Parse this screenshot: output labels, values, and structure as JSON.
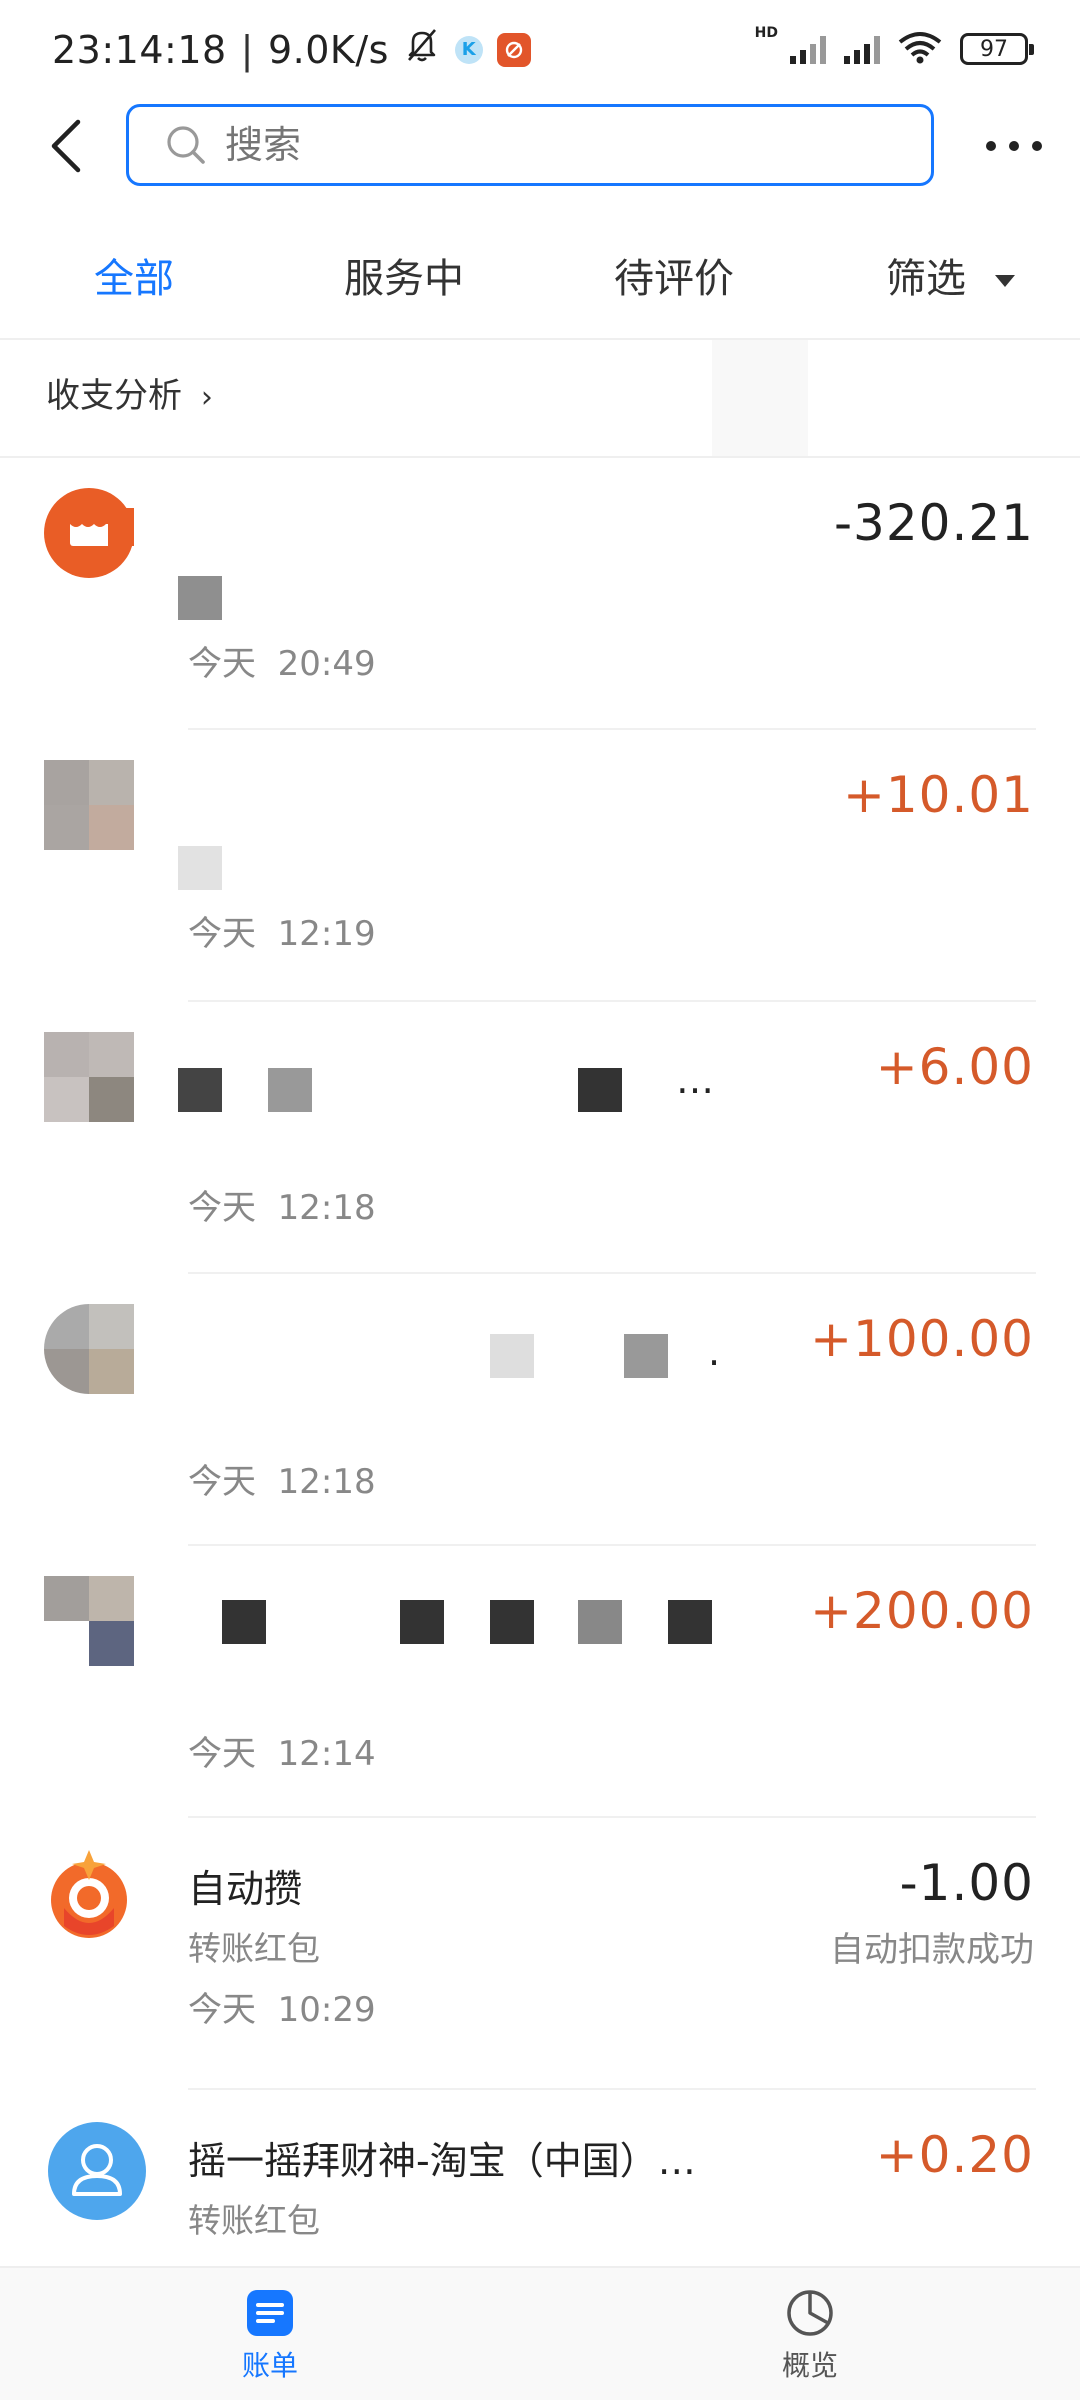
{
  "status_bar": {
    "time": "23:14:18",
    "separator": "|",
    "net_speed": "9.0K/s",
    "icons": [
      "bell-muted-icon",
      "k-app-icon",
      "app-notification-icon"
    ],
    "right_icons": [
      "hd-signal-icon",
      "signal-icon",
      "wifi-icon"
    ],
    "hd_label": "HD",
    "battery": "97"
  },
  "header": {
    "search_placeholder": "搜索"
  },
  "tabs": {
    "all": "全部",
    "in_service": "服务中",
    "pending_review": "待评价",
    "filter": "筛选"
  },
  "analysis": {
    "label": "收支分析",
    "chevron": "›"
  },
  "transactions": [
    {
      "title": "",
      "subtitle": "",
      "date": "今天",
      "time": "20:49",
      "amount": "-320.21",
      "status": ""
    },
    {
      "title": "",
      "subtitle": "",
      "date": "今天",
      "time": "12:19",
      "amount": "+10.01",
      "status": ""
    },
    {
      "title": "…",
      "subtitle": "",
      "date": "今天",
      "time": "12:18",
      "amount": "+6.00",
      "status": ""
    },
    {
      "title": ".",
      "subtitle": "",
      "date": "今天",
      "time": "12:18",
      "amount": "+100.00",
      "status": ""
    },
    {
      "title": "",
      "subtitle": "",
      "date": "今天",
      "time": "12:14",
      "amount": "+200.00",
      "status": ""
    },
    {
      "title": "自动攒",
      "subtitle": "转账红包",
      "date": "今天",
      "time": "10:29",
      "amount": "-1.00",
      "status": "自动扣款成功"
    },
    {
      "title": "摇一摇拜财神-淘宝（中国）…",
      "subtitle": "转账红包",
      "date": "",
      "time": "",
      "amount": "+0.20",
      "status": ""
    }
  ],
  "bottom_nav": {
    "bills": "账单",
    "overview": "概览"
  },
  "colors": {
    "accent": "#1677ff",
    "income": "#d55a2a",
    "expense": "#222222"
  }
}
